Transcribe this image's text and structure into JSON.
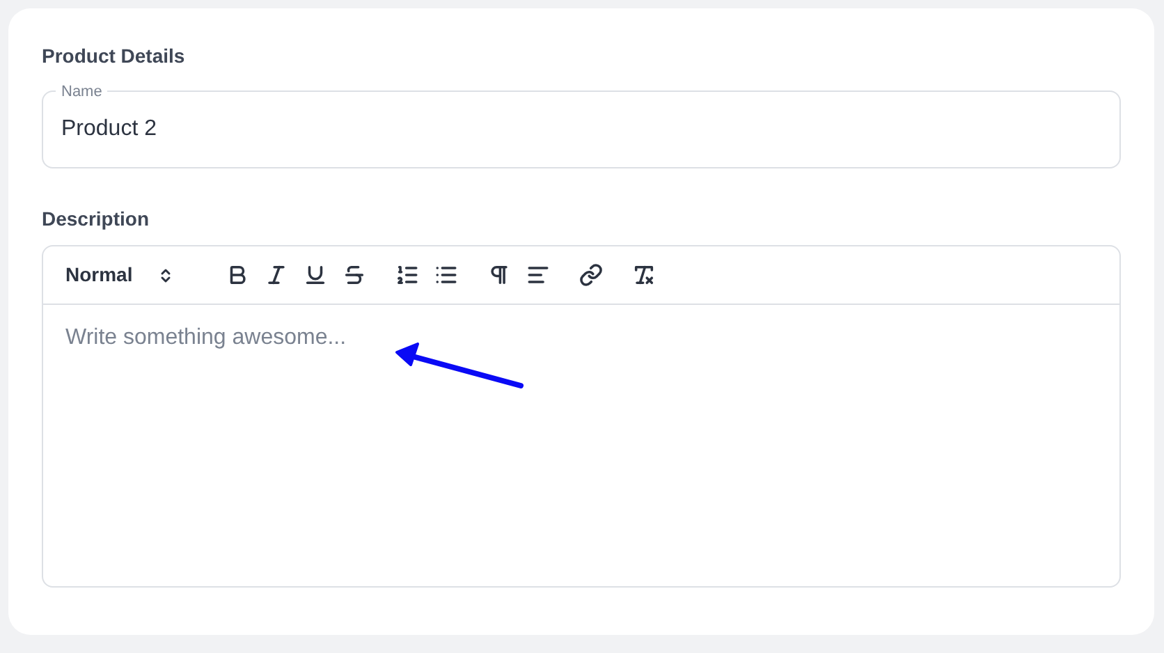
{
  "card": {
    "title": "Product Details"
  },
  "name_field": {
    "label": "Name",
    "value": "Product 2"
  },
  "description": {
    "label": "Description",
    "editor": {
      "format": "Normal",
      "toolbar_groups": [
        [
          {
            "kind": "bold"
          },
          {
            "kind": "italic"
          },
          {
            "kind": "underline"
          },
          {
            "kind": "strike"
          }
        ],
        [
          {
            "kind": "ordered-list"
          },
          {
            "kind": "bullet-list"
          }
        ],
        [
          {
            "kind": "text-direction"
          },
          {
            "kind": "align"
          }
        ],
        [
          {
            "kind": "link"
          }
        ],
        [
          {
            "kind": "clear-format"
          }
        ]
      ],
      "placeholder": "Write something awesome..."
    }
  }
}
